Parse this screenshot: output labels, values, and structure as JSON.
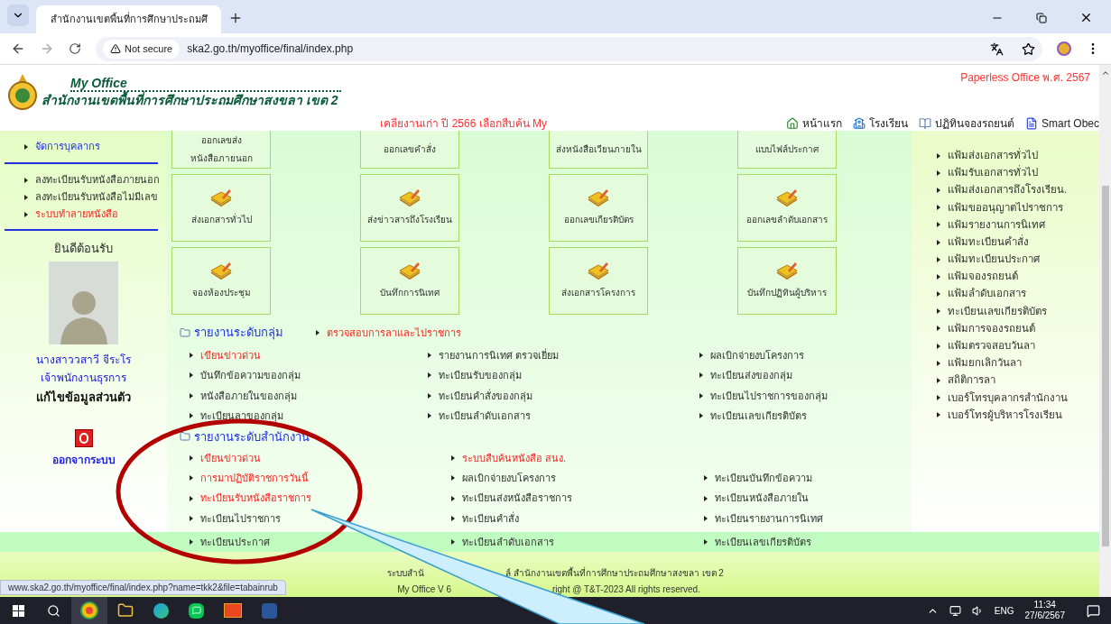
{
  "browser": {
    "tabs": [
      {
        "title": "สำนักงานเขตพื้นที่การศึกษาประถมศึ",
        "selected": true
      }
    ],
    "security": "Not secure",
    "url": "ska2.go.th/myoffice/final/index.php"
  },
  "header": {
    "brand": "My Office",
    "organization": "สำนักงานเขตพื้นที่การศึกษาประถมศึกษาสงขลา เขต 2",
    "edition": "Paperless Office พ.ศ. 2567",
    "notice": "เคลียงานเก่า ปี 2566 เลือกสืบค้น My",
    "nav": [
      {
        "label": "หน้าแรก",
        "kind": "home"
      },
      {
        "label": "โรงเรียน",
        "kind": "school"
      },
      {
        "label": "ปฏิทินจองรถยนต์",
        "kind": "calendar"
      },
      {
        "label": "Smart Obec",
        "kind": "document"
      }
    ]
  },
  "sidebar": {
    "menus": [
      [
        {
          "label": "จัดการบุคลากร",
          "kind": "primary"
        }
      ],
      [
        {
          "label": "ลงทะเบียนรับหนังสือภายนอก",
          "kind": "normal"
        },
        {
          "label": "ลงทะเบียนรับหนังสือไม่มีเลข",
          "kind": "normal"
        },
        {
          "label": "ระบบทำลายหนังสือ",
          "kind": "alert"
        }
      ]
    ],
    "welcome": "ยินดีต้อนรับ",
    "user_name": "นางสาววสาวี จีระโร",
    "user_position": "เจ้าพนักงานธุรการ",
    "edit_profile": "แก้ไขข้อมูลส่วนตัว",
    "logout": "ออกจากระบบ"
  },
  "tiles": [
    [
      {
        "label": "ออกเลขส่ง\nหนังสือภายนอก",
        "icon": false
      },
      {
        "label": "ออกเลขคำสั่ง",
        "icon": false
      },
      {
        "label": "ส่งหนังสือเวียนภายใน",
        "icon": false
      },
      {
        "label": "แบบไฟล์ประกาศ",
        "icon": false
      }
    ],
    [
      {
        "label": "ส่งเอกสารทั่วไป",
        "icon": true
      },
      {
        "label": "ส่งข่าวสารถึงโรงเรียน",
        "icon": true
      },
      {
        "label": "ออกเลขเกียรติบัตร",
        "icon": true
      },
      {
        "label": "ออกเลขลำดับเอกสาร",
        "icon": true
      }
    ],
    [
      {
        "label": "จองห้องประชุม",
        "icon": true
      },
      {
        "label": "บันทึกการนิเทศ",
        "icon": true
      },
      {
        "label": "ส่งเอกสารโครงการ",
        "icon": true
      },
      {
        "label": "บันทึกปฏิทินผู้บริหาร",
        "icon": true
      }
    ]
  ],
  "group_report": {
    "title": "รายงานระดับกลุ่ม",
    "extra_link": {
      "label": "ตรวจสอบการลาและไปราชการ",
      "kind": "alert"
    },
    "rows": [
      [
        {
          "label": "เขียนข่าวด่วน",
          "kind": "alert"
        },
        {
          "label": "รายงานการนิเทศ ตรวจเยี่ยม",
          "kind": "normal"
        },
        {
          "label": "ผลเบิกจ่ายงบโครงการ",
          "kind": "normal"
        }
      ],
      [
        {
          "label": "บันทึกข้อความของกลุ่ม",
          "kind": "normal"
        },
        {
          "label": "ทะเบียนรับของกลุ่ม",
          "kind": "normal"
        },
        {
          "label": "ทะเบียนส่งของกลุ่ม",
          "kind": "normal"
        }
      ],
      [
        {
          "label": "หนังสือภายในของกลุ่ม",
          "kind": "normal"
        },
        {
          "label": "ทะเบียนคำสั่งของกลุ่ม",
          "kind": "normal"
        },
        {
          "label": "ทะเบียนไปราชการของกลุ่ม",
          "kind": "normal"
        }
      ],
      [
        {
          "label": "ทะเบียนลาของกลุ่ม",
          "kind": "normal"
        },
        {
          "label": "ทะเบียนลำดับเอกสาร",
          "kind": "normal"
        },
        {
          "label": "ทะเบียนเลขเกียรติบัตร",
          "kind": "normal"
        }
      ]
    ]
  },
  "office_report": {
    "title": "รายงานระดับสำนักงาน",
    "rows": [
      {
        "highlighted": false,
        "cells": [
          {
            "label": "เขียนข่าวด่วน",
            "kind": "alert"
          },
          {
            "label": "ระบบสืบค้นหนังสือ สนง.",
            "kind": "alert"
          }
        ]
      },
      {
        "highlighted": false,
        "cells": [
          {
            "label": "การมาปฏิบัติราชการวันนี้",
            "kind": "alert"
          },
          {
            "label": "ผลเบิกจ่ายงบโครงการ",
            "kind": "normal"
          },
          {
            "label": "ทะเบียนบันทึกข้อความ",
            "kind": "normal"
          }
        ]
      },
      {
        "highlighted": false,
        "cells": [
          {
            "label": "ทะเบียนรับหนังสือราชการ",
            "kind": "alert"
          },
          {
            "label": "ทะเบียนส่งหนังสือราชการ",
            "kind": "normal"
          },
          {
            "label": "ทะเบียนหนังสือภายใน",
            "kind": "normal"
          }
        ]
      },
      {
        "highlighted": false,
        "cells": [
          {
            "label": "ทะเบียนไปราชการ",
            "kind": "normal"
          },
          {
            "label": "ทะเบียนคำสั่ง",
            "kind": "normal"
          },
          {
            "label": "ทะเบียนรายงานการนิเทศ",
            "kind": "normal"
          }
        ]
      },
      {
        "highlighted": true,
        "cells": [
          {
            "label": "ทะเบียนประกาศ",
            "kind": "normal"
          },
          {
            "label": "ทะเบียนลำดับเอกสาร",
            "kind": "normal"
          },
          {
            "label": "ทะเบียนเลขเกียรติบัตร",
            "kind": "normal"
          }
        ]
      }
    ]
  },
  "right_links": [
    "แฟ้มส่งเอกสารทั่วไป",
    "แฟ้มรับเอกสารทั่วไป",
    "แฟ้มส่งเอกสารถึงโรงเรียน.",
    "แฟ้มขออนุญาตไปราชการ",
    "แฟ้มรายงานการนิเทศ",
    "แฟ้มทะเบียนคำสั่ง",
    "แฟ้มทะเบียนประกาศ",
    "แฟ้มจองรถยนต์",
    "แฟ้มลำดับเอกสาร",
    "ทะเบียนเลขเกียรติบัตร",
    "แฟ้มการจองรถยนต์",
    "แฟ้มตรวจสอบวันลา",
    "แฟ้มยกเลิกวันลา",
    "สถิติการลา",
    "เบอร์โทรบุคลากรสำนักงาน",
    "เบอร์โทรผู้บริหารโรงเรียน"
  ],
  "footer": {
    "line_1_start": "ระบบสำนั",
    "line_1_end": "ล์ สำนักงานเขตพื้นที่การศึกษาประถมศึกษาสงขลา เขต 2",
    "line_2_start": "My Office V 6",
    "line_2_end": "right @ T&T-2023 All rights reserved."
  },
  "status_url": "www.ska2.go.th/myoffice/final/index.php?name=tkk2&file=tabainrub",
  "taskbar": {
    "language": "ENG",
    "time": "11:34",
    "date": "27/6/2567"
  }
}
